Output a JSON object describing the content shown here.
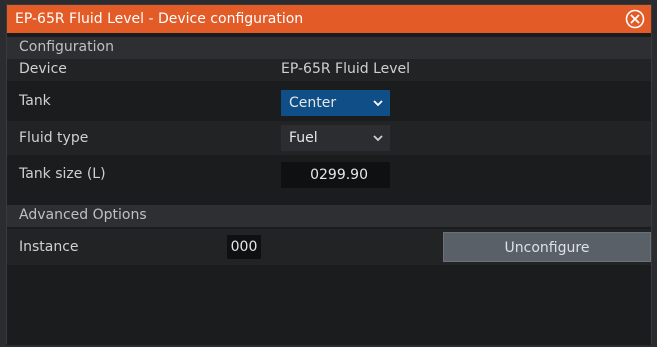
{
  "dialog": {
    "title": "EP-65R Fluid Level - Device configuration",
    "close_icon": "close-circle-icon",
    "accent_color": "#e35b27"
  },
  "configuration": {
    "section_label": "Configuration",
    "device_label": "Device",
    "device_value": "EP-65R Fluid Level",
    "tank_label": "Tank",
    "tank_value": "Center",
    "fluid_type_label": "Fluid type",
    "fluid_type_value": "Fuel",
    "tank_size_label": "Tank size (L)",
    "tank_size_value": "0299.90"
  },
  "advanced": {
    "section_label": "Advanced Options",
    "instance_label": "Instance",
    "instance_value": "000",
    "unconfigure_label": "Unconfigure"
  }
}
